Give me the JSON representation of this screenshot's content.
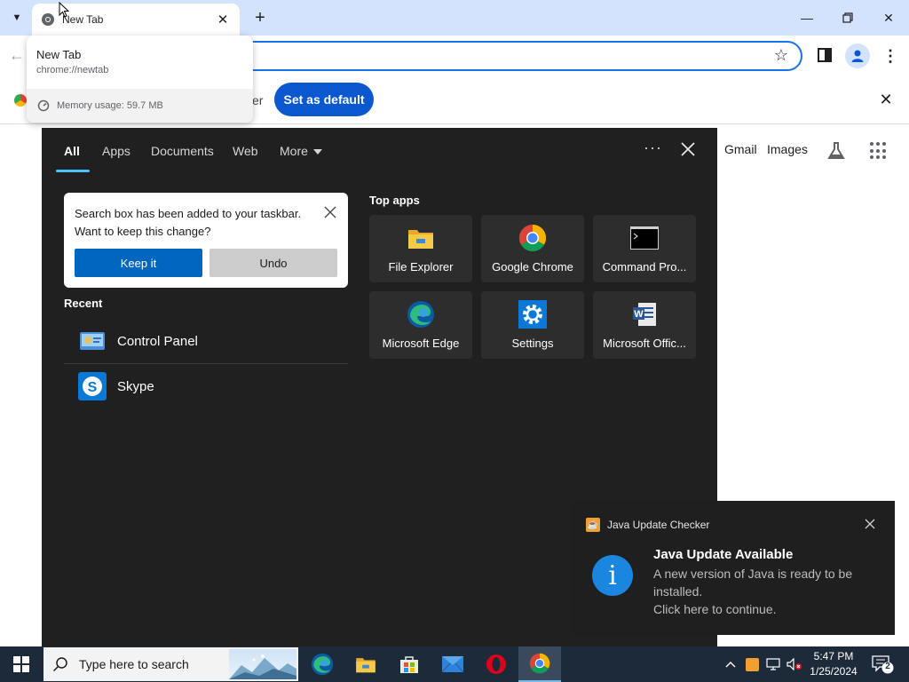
{
  "browser": {
    "tab": {
      "title": "New Tab"
    },
    "hovercard": {
      "title": "New Tab",
      "url": "chrome://newtab",
      "memory": "Memory usage: 59.7 MB"
    },
    "infobar": {
      "text_fragment": "er",
      "set_default_label": "Set as default"
    },
    "ntp_links": {
      "gmail": "Gmail",
      "images": "Images"
    }
  },
  "search_panel": {
    "tabs": [
      {
        "label": "All"
      },
      {
        "label": "Apps"
      },
      {
        "label": "Documents"
      },
      {
        "label": "Web"
      },
      {
        "label": "More"
      }
    ],
    "tip": {
      "text": "Search box has been added to your taskbar. Want to keep this change?",
      "keep_label": "Keep it",
      "undo_label": "Undo"
    },
    "recent_heading": "Recent",
    "recent": [
      {
        "label": "Control Panel",
        "icon": "control-panel-icon"
      },
      {
        "label": "Skype",
        "icon": "skype-icon"
      }
    ],
    "top_apps_heading": "Top apps",
    "top_apps": [
      {
        "label": "File Explorer",
        "icon": "file-explorer-icon"
      },
      {
        "label": "Google Chrome",
        "icon": "chrome-icon"
      },
      {
        "label": "Command Pro...",
        "icon": "command-prompt-icon"
      },
      {
        "label": "Microsoft Edge",
        "icon": "edge-icon"
      },
      {
        "label": "Settings",
        "icon": "settings-gear-icon"
      },
      {
        "label": "Microsoft Offic...",
        "icon": "office-word-icon"
      }
    ]
  },
  "toast": {
    "app_name": "Java Update Checker",
    "title": "Java Update Available",
    "line1": "A new version of Java is ready to be installed.",
    "line2": "Click here to continue."
  },
  "taskbar": {
    "search_placeholder": "Type here to search",
    "time": "5:47 PM",
    "date": "1/25/2024",
    "notification_count": "2"
  },
  "colors": {
    "accent_blue": "#0b57d0",
    "win_accent": "#0067c0",
    "tab_underline": "#4cc2ff",
    "panel_bg": "#202020",
    "taskbar_bg": "#1c2a3a"
  }
}
